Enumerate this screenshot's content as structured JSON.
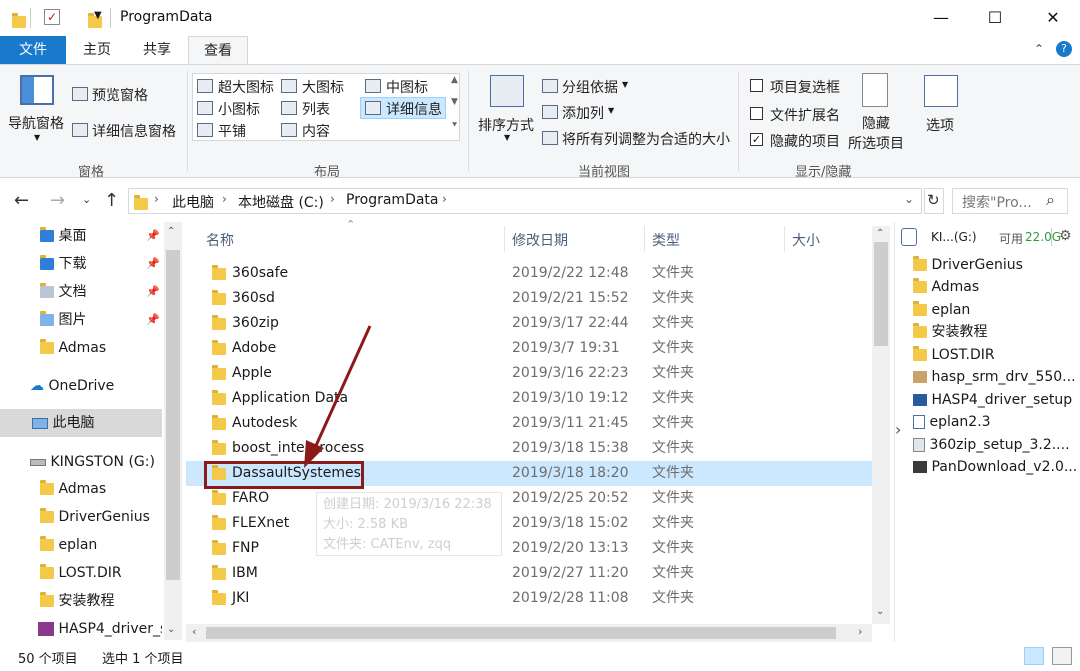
{
  "window": {
    "title": "ProgramData",
    "minimize_icon": "—",
    "maximize_icon": "☐",
    "close_icon": "✕"
  },
  "tabs": {
    "file": "文件",
    "home": "主页",
    "share": "共享",
    "view": "查看"
  },
  "ribbon": {
    "panes": {
      "nav_pane": "导航窗格",
      "preview_pane": "预览窗格",
      "details_pane": "详细信息窗格",
      "label": "窗格"
    },
    "layout": {
      "extra_large": "超大图标",
      "large": "大图标",
      "medium": "中图标",
      "small": "小图标",
      "list": "列表",
      "details": "详细信息",
      "tiles": "平铺",
      "content": "内容",
      "label": "布局"
    },
    "current_view": {
      "sort_by": "排序方式",
      "group_by": "分组依据",
      "add_column": "添加列",
      "fit_columns": "将所有列调整为合适的大小",
      "label": "当前视图"
    },
    "show_hide": {
      "item_checkboxes": "项目复选框",
      "file_extensions": "文件扩展名",
      "hidden_items": "隐藏的项目",
      "hide_selected_line1": "隐藏",
      "hide_selected_line2": "所选项目",
      "options": "选项",
      "label": "显示/隐藏",
      "item_checkboxes_checked": false,
      "file_extensions_checked": false,
      "hidden_items_checked": true
    }
  },
  "address": {
    "crumbs": [
      "此电脑",
      "本地磁盘 (C:)",
      "ProgramData"
    ],
    "search_placeholder": "搜索\"Pro..."
  },
  "nav": {
    "quick": [
      {
        "label": "桌面",
        "pinned": true
      },
      {
        "label": "下载",
        "pinned": true
      },
      {
        "label": "文档",
        "pinned": true
      },
      {
        "label": "图片",
        "pinned": true
      },
      {
        "label": "Admas",
        "pinned": false
      }
    ],
    "onedrive": "OneDrive",
    "this_pc": "此电脑",
    "drive": "KINGSTON (G:)",
    "drive_items": [
      "Admas",
      "DriverGenius",
      "eplan",
      "LOST.DIR",
      "安装教程",
      "HASP4_driver_s"
    ]
  },
  "list": {
    "columns": {
      "name": "名称",
      "date": "修改日期",
      "type": "类型",
      "size": "大小"
    },
    "rows": [
      {
        "name": "360safe",
        "date": "2019/2/22 12:48",
        "type": "文件夹"
      },
      {
        "name": "360sd",
        "date": "2019/2/21 15:52",
        "type": "文件夹"
      },
      {
        "name": "360zip",
        "date": "2019/3/17 22:44",
        "type": "文件夹"
      },
      {
        "name": "Adobe",
        "date": "2019/3/7 19:31",
        "type": "文件夹"
      },
      {
        "name": "Apple",
        "date": "2019/3/16 22:23",
        "type": "文件夹"
      },
      {
        "name": "Application Data",
        "date": "2019/3/10 19:12",
        "type": "文件夹"
      },
      {
        "name": "Autodesk",
        "date": "2019/3/11 21:45",
        "type": "文件夹"
      },
      {
        "name": "boost_interprocess",
        "date": "2019/3/18 15:38",
        "type": "文件夹"
      },
      {
        "name": "DassaultSystemes",
        "date": "2019/3/18 18:20",
        "type": "文件夹"
      },
      {
        "name": "FARO",
        "date": "2019/2/25 20:52",
        "type": "文件夹"
      },
      {
        "name": "FLEXnet",
        "date": "2019/3/18 15:02",
        "type": "文件夹"
      },
      {
        "name": "FNP",
        "date": "2019/2/20 13:13",
        "type": "文件夹"
      },
      {
        "name": "IBM",
        "date": "2019/2/27 11:20",
        "type": "文件夹"
      },
      {
        "name": "JKI",
        "date": "2019/2/28 11:08",
        "type": "文件夹"
      }
    ],
    "tooltip": {
      "created": "创建日期: 2019/3/16 22:38",
      "size": "大小: 2.58 KB",
      "folders": "文件夹: CATEnv, zqq"
    }
  },
  "right_pane": {
    "drive": "KI...(G:)",
    "free_label": "可用",
    "free_value": "22.0G",
    "items": [
      "DriverGenius",
      "Admas",
      "eplan",
      "安装教程",
      "LOST.DIR",
      "hasp_srm_drv_550...",
      "HASP4_driver_setup",
      "eplan2.3",
      "360zip_setup_3.2....",
      "PanDownload_v2.0..."
    ]
  },
  "status": {
    "count": "50 个项目",
    "selected": "选中 1 个项目"
  },
  "colors": {
    "accent": "#1979ca",
    "selection": "#cce8ff",
    "highlight_box": "#8b1a1a",
    "free_space": "#2e9b3a"
  }
}
